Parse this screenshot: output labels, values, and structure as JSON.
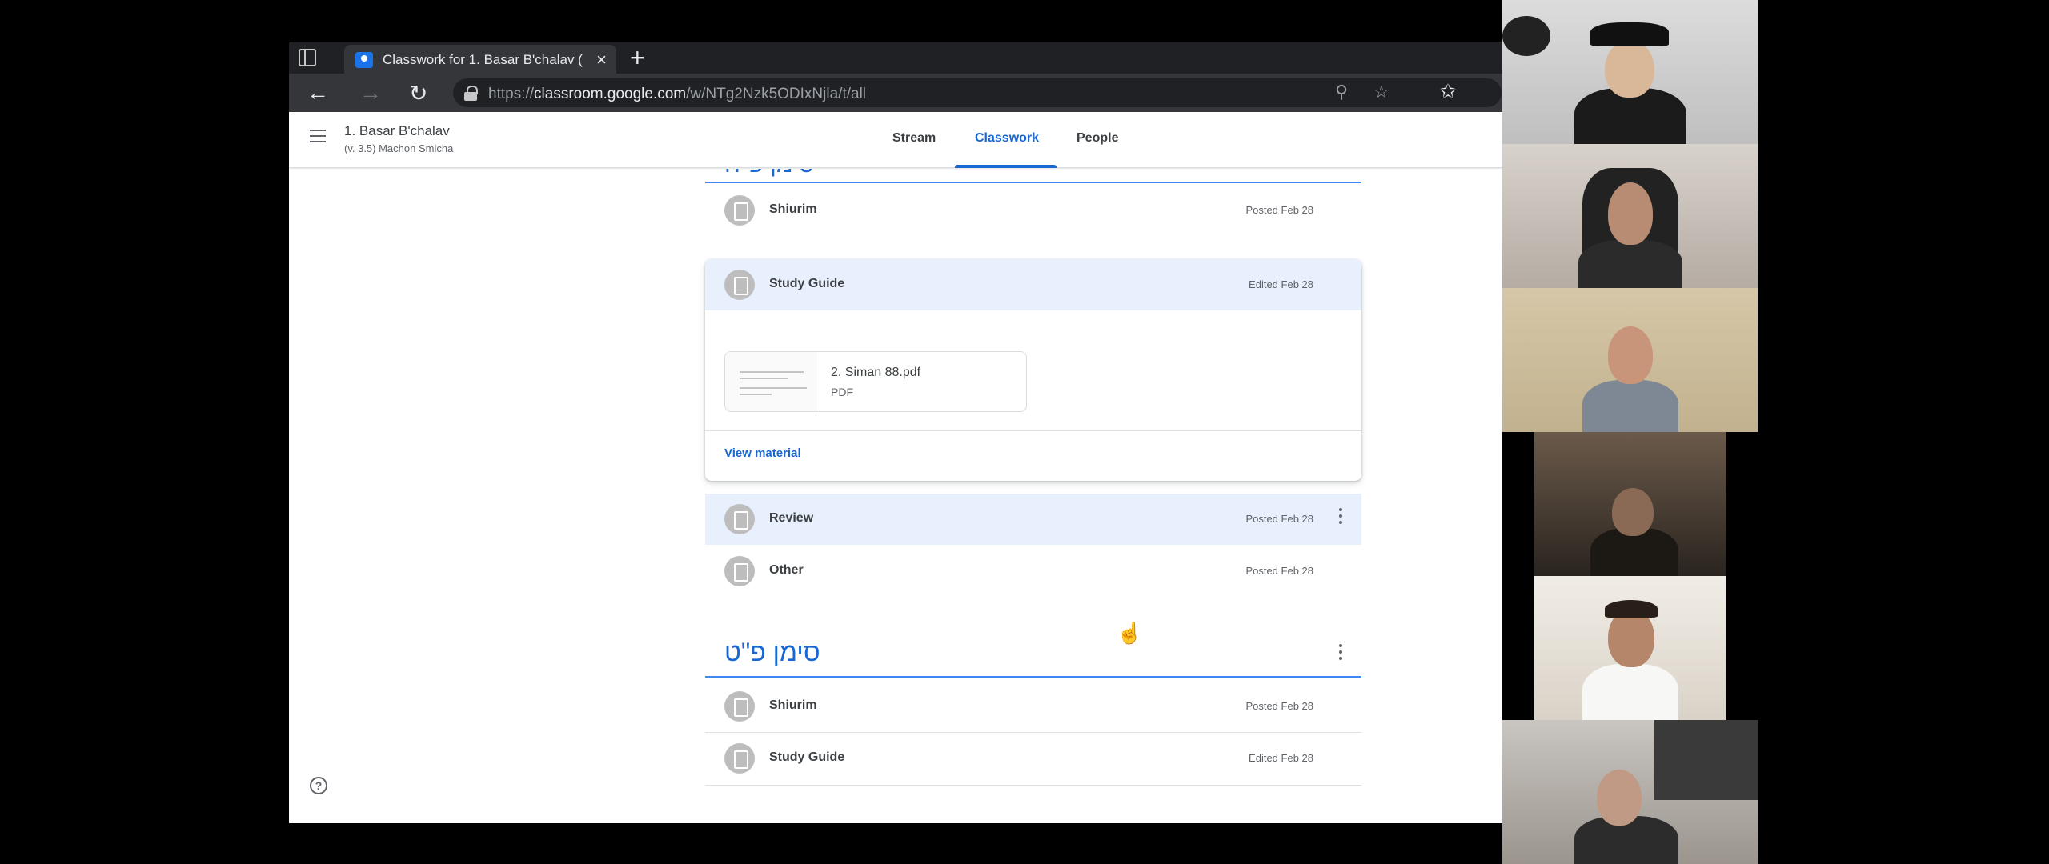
{
  "browser": {
    "tab_title": "Classwork for 1. Basar B'chalav (",
    "url_prefix": "https://",
    "url_host": "classroom.google.com",
    "url_path": "/w/NTg2Nzk5ODIxNjla/t/all"
  },
  "header": {
    "class_name": "1. Basar B'chalav",
    "class_section": "(v. 3.5) Machon Smicha",
    "tabs": [
      "Stream",
      "Classwork",
      "People"
    ],
    "active_tab": "Classwork"
  },
  "topics": [
    {
      "title": "סימן פ\"ח",
      "items": [
        {
          "title": "Shiurim",
          "date": "Posted Feb 28"
        },
        {
          "title": "Study Guide",
          "date": "Edited Feb 28",
          "expanded": true,
          "attachment": {
            "name": "2. Siman 88.pdf",
            "type": "PDF"
          },
          "view_label": "View material"
        },
        {
          "title": "Review",
          "date": "Posted Feb 28"
        },
        {
          "title": "Other",
          "date": "Posted Feb 28"
        }
      ]
    },
    {
      "title": "סימן פ\"ט",
      "items": [
        {
          "title": "Shiurim",
          "date": "Posted Feb 28"
        },
        {
          "title": "Study Guide",
          "date": "Edited Feb 28"
        }
      ]
    }
  ],
  "icons": {
    "help": "?"
  }
}
